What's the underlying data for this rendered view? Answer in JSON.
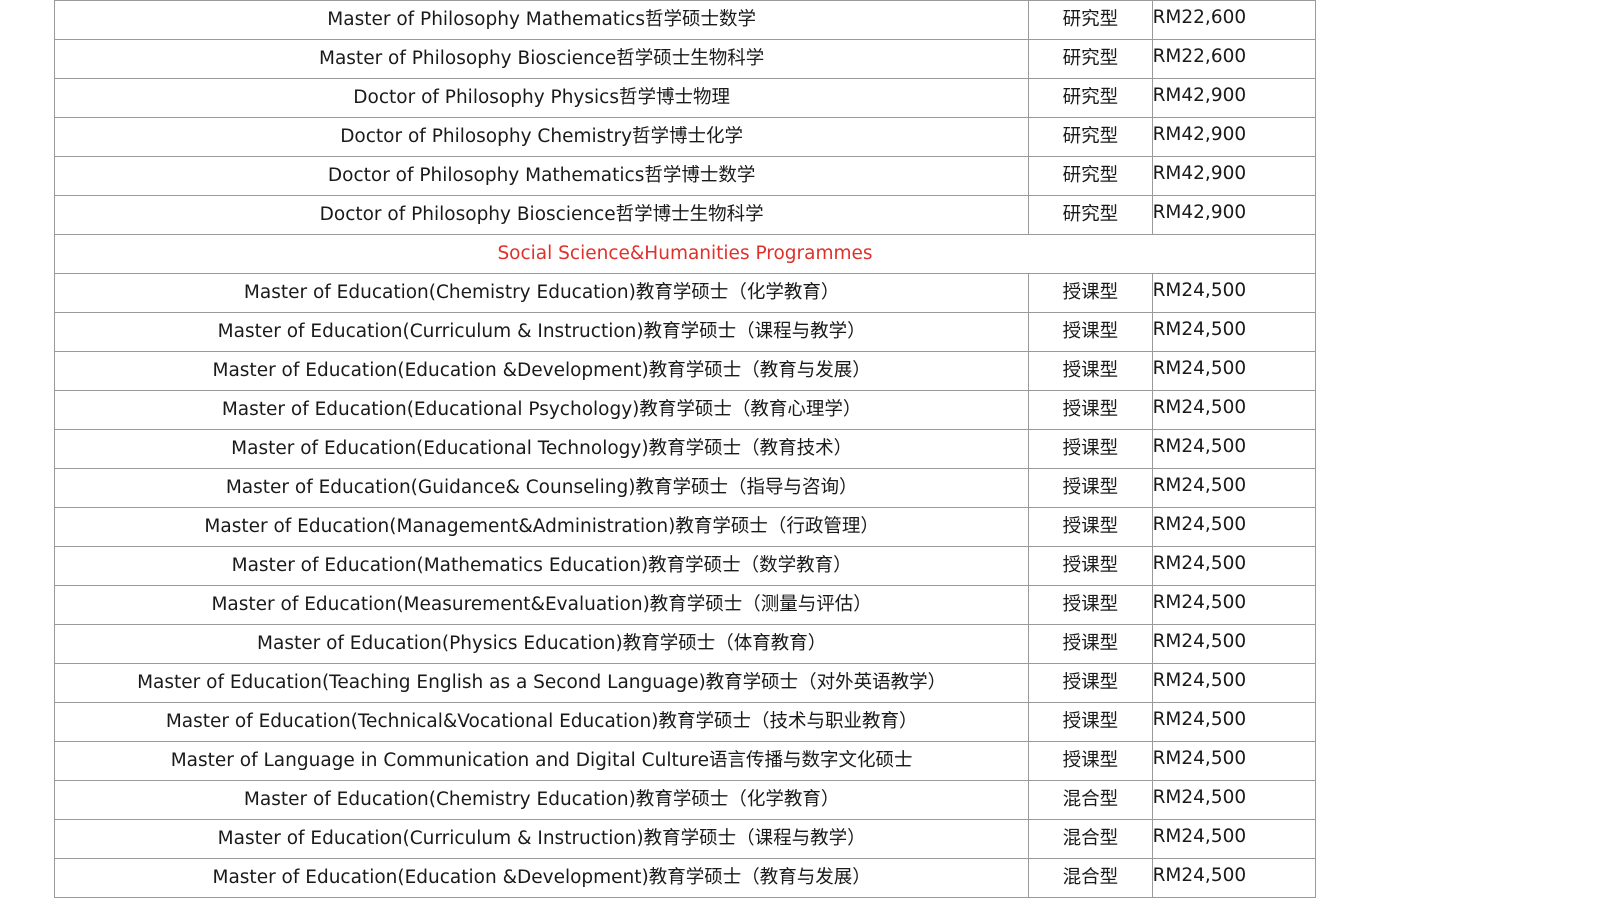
{
  "rows_before": [
    {
      "name": "Master of Philosophy Mathematics哲学硕士数学",
      "type": "研究型",
      "fee": "RM22,600"
    },
    {
      "name": "Master of Philosophy Bioscience哲学硕士生物科学",
      "type": "研究型",
      "fee": "RM22,600"
    },
    {
      "name": "Doctor of Philosophy Physics哲学博士物理",
      "type": "研究型",
      "fee": "RM42,900"
    },
    {
      "name": "Doctor of Philosophy Chemistry哲学博士化学",
      "type": "研究型",
      "fee": "RM42,900"
    },
    {
      "name": "Doctor of Philosophy Mathematics哲学博士数学",
      "type": "研究型",
      "fee": "RM42,900"
    },
    {
      "name": "Doctor of Philosophy Bioscience哲学博士生物科学",
      "type": "研究型",
      "fee": "RM42,900"
    }
  ],
  "section_heading": "Social Science&Humanities Programmes",
  "section_color": "#e0302a",
  "rows_after": [
    {
      "name": "Master of Education(Chemistry Education)教育学硕士（化学教育）",
      "type": "授课型",
      "fee": "RM24,500"
    },
    {
      "name": "Master of Education(Curriculum & Instruction)教育学硕士（课程与教学）",
      "type": "授课型",
      "fee": "RM24,500"
    },
    {
      "name": "Master of Education(Education &Development)教育学硕士（教育与发展）",
      "type": "授课型",
      "fee": "RM24,500"
    },
    {
      "name": "Master of Education(Educational Psychology)教育学硕士（教育心理学）",
      "type": "授课型",
      "fee": "RM24,500"
    },
    {
      "name": "Master of Education(Educational Technology)教育学硕士（教育技术）",
      "type": "授课型",
      "fee": "RM24,500"
    },
    {
      "name": "Master of Education(Guidance& Counseling)教育学硕士（指导与咨询）",
      "type": "授课型",
      "fee": "RM24,500"
    },
    {
      "name": "Master of Education(Management&Administration)教育学硕士（行政管理）",
      "type": "授课型",
      "fee": "RM24,500"
    },
    {
      "name": "Master of Education(Mathematics Education)教育学硕士（数学教育）",
      "type": "授课型",
      "fee": "RM24,500"
    },
    {
      "name": "Master of Education(Measurement&Evaluation)教育学硕士（测量与评估）",
      "type": "授课型",
      "fee": "RM24,500"
    },
    {
      "name": "Master of Education(Physics Education)教育学硕士（体育教育）",
      "type": "授课型",
      "fee": "RM24,500"
    },
    {
      "name": "Master of Education(Teaching English as a Second Language)教育学硕士（对外英语教学）",
      "type": "授课型",
      "fee": "RM24,500"
    },
    {
      "name": "Master of Education(Technical&Vocational Education)教育学硕士（技术与职业教育）",
      "type": "授课型",
      "fee": "RM24,500"
    },
    {
      "name": "Master of Language in Communication and Digital Culture语言传播与数字文化硕士",
      "type": "授课型",
      "fee": "RM24,500"
    },
    {
      "name": "Master of Education(Chemistry Education)教育学硕士（化学教育）",
      "type": "混合型",
      "fee": "RM24,500"
    },
    {
      "name": "Master of Education(Curriculum & Instruction)教育学硕士（课程与教学）",
      "type": "混合型",
      "fee": "RM24,500"
    },
    {
      "name": "Master of Education(Education &Development)教育学硕士（教育与发展）",
      "type": "混合型",
      "fee": "RM24,500"
    }
  ]
}
